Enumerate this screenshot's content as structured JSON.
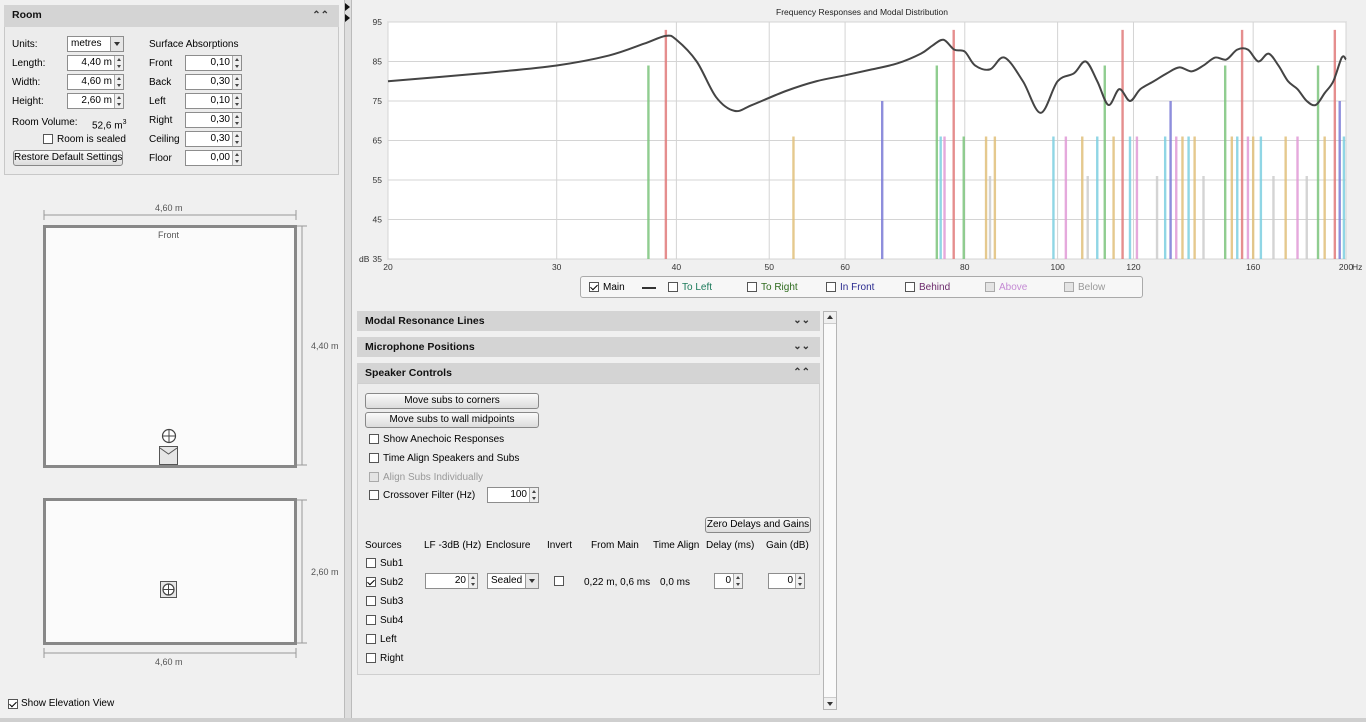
{
  "room": {
    "title": "Room",
    "units_label": "Units:",
    "units_value": "metres",
    "length_label": "Length:",
    "length_value": "4,40 m",
    "width_label": "Width:",
    "width_value": "4,60 m",
    "height_label": "Height:",
    "height_value": "2,60 m",
    "volume_label": "Room Volume:",
    "volume_value": "52,6 m",
    "volume_exp": "3",
    "sealed_label": "Room is sealed",
    "restore_button": "Restore Default Settings",
    "absorption_title": "Surface Absorptions",
    "surfaces": [
      {
        "label": "Front",
        "value": "0,10"
      },
      {
        "label": "Back",
        "value": "0,30"
      },
      {
        "label": "Left",
        "value": "0,10"
      },
      {
        "label": "Right",
        "value": "0,30"
      },
      {
        "label": "Ceiling",
        "value": "0,30"
      },
      {
        "label": "Floor",
        "value": "0,00"
      }
    ]
  },
  "plan": {
    "top_width": "4,60 m",
    "front_label": "Front",
    "depth": "4,40 m",
    "elev_height": "2,60 m",
    "bottom_width": "4,60 m",
    "show_elevation_label": "Show Elevation View"
  },
  "chart_data": {
    "type": "line",
    "title": "Frequency Responses and Modal Distribution",
    "xlabel": "Hz",
    "ylabel": "dB",
    "x_scale": "log",
    "xlim": [
      20,
      200
    ],
    "ylim": [
      35,
      95
    ],
    "x_ticks": [
      "20",
      "30",
      "40",
      "50",
      "60",
      "80",
      "100",
      "120",
      "160",
      "200"
    ],
    "y_ticks": [
      "95",
      "85",
      "75",
      "65",
      "55",
      "45",
      "35"
    ],
    "grid": true,
    "series": [
      {
        "name": "Main",
        "color": "#444444",
        "x": [
          20,
          25,
          30,
          34,
          37,
          39,
          40,
          42,
          44,
          46,
          48,
          52,
          56,
          60,
          64,
          68,
          72,
          74,
          76,
          78,
          80,
          82,
          85,
          88,
          92,
          96,
          100,
          104,
          107,
          110,
          113,
          116,
          119,
          122,
          126,
          130,
          134,
          138,
          142,
          146,
          150,
          154,
          158,
          162,
          166,
          170,
          174,
          178,
          182,
          186,
          190,
          194,
          198,
          200
        ],
        "y": [
          80,
          82,
          84,
          86.5,
          89.5,
          91.5,
          90.5,
          85,
          76,
          72.5,
          74,
          77.5,
          80,
          81.5,
          83,
          84.5,
          87,
          89,
          90.5,
          88,
          87.5,
          84,
          83,
          86,
          80,
          72,
          80,
          82,
          85,
          80,
          74,
          78,
          75,
          78,
          80,
          82,
          83.5,
          82.5,
          84,
          86,
          85.5,
          88,
          88,
          85,
          87,
          84,
          80,
          78,
          75,
          74,
          77,
          80,
          86,
          85.5
        ]
      }
    ],
    "modes": [
      {
        "f": 37.4,
        "db": 84,
        "color": "#7dc47d"
      },
      {
        "f": 39.0,
        "db": 93,
        "color": "#e07a7a"
      },
      {
        "f": 53.0,
        "db": 66,
        "color": "#e0c07a"
      },
      {
        "f": 65.6,
        "db": 75,
        "color": "#7a7ad6"
      },
      {
        "f": 74.8,
        "db": 84,
        "color": "#7dc47d"
      },
      {
        "f": 75.5,
        "db": 66,
        "color": "#7dcfe0"
      },
      {
        "f": 76.2,
        "db": 66,
        "color": "#e09ad6"
      },
      {
        "f": 77.9,
        "db": 93,
        "color": "#e07a7a"
      },
      {
        "f": 79.8,
        "db": 66,
        "color": "#7dc47d"
      },
      {
        "f": 84.2,
        "db": 66,
        "color": "#e0c07a"
      },
      {
        "f": 85.0,
        "db": 56,
        "color": "#cccccc"
      },
      {
        "f": 86.0,
        "db": 66,
        "color": "#e0c07a"
      },
      {
        "f": 99.0,
        "db": 66,
        "color": "#7dcfe0"
      },
      {
        "f": 102.0,
        "db": 66,
        "color": "#e09ad6"
      },
      {
        "f": 106.1,
        "db": 66,
        "color": "#e0c07a"
      },
      {
        "f": 107.5,
        "db": 56,
        "color": "#cccccc"
      },
      {
        "f": 110.0,
        "db": 66,
        "color": "#7dcfe0"
      },
      {
        "f": 112.0,
        "db": 84,
        "color": "#7dc47d"
      },
      {
        "f": 114.4,
        "db": 66,
        "color": "#e0c07a"
      },
      {
        "f": 116.9,
        "db": 93,
        "color": "#e07a7a"
      },
      {
        "f": 119.0,
        "db": 66,
        "color": "#7dcfe0"
      },
      {
        "f": 121.0,
        "db": 66,
        "color": "#e09ad6"
      },
      {
        "f": 127.0,
        "db": 56,
        "color": "#cccccc"
      },
      {
        "f": 129.5,
        "db": 66,
        "color": "#7dcfe0"
      },
      {
        "f": 131.2,
        "db": 75,
        "color": "#7a7ad6"
      },
      {
        "f": 133.0,
        "db": 66,
        "color": "#e09ad6"
      },
      {
        "f": 135.0,
        "db": 66,
        "color": "#e0c07a"
      },
      {
        "f": 137.0,
        "db": 66,
        "color": "#7dcfe0"
      },
      {
        "f": 139.0,
        "db": 66,
        "color": "#e0c07a"
      },
      {
        "f": 142.0,
        "db": 56,
        "color": "#cccccc"
      },
      {
        "f": 149.6,
        "db": 84,
        "color": "#7dc47d"
      },
      {
        "f": 152.0,
        "db": 66,
        "color": "#e0c07a"
      },
      {
        "f": 154.0,
        "db": 66,
        "color": "#7dcfe0"
      },
      {
        "f": 155.8,
        "db": 93,
        "color": "#e07a7a"
      },
      {
        "f": 158.0,
        "db": 66,
        "color": "#e09ad6"
      },
      {
        "f": 160.0,
        "db": 66,
        "color": "#e0c07a"
      },
      {
        "f": 163.0,
        "db": 66,
        "color": "#7dcfe0"
      },
      {
        "f": 168.0,
        "db": 56,
        "color": "#cccccc"
      },
      {
        "f": 173.0,
        "db": 66,
        "color": "#e0c07a"
      },
      {
        "f": 178.0,
        "db": 66,
        "color": "#e09ad6"
      },
      {
        "f": 182.0,
        "db": 56,
        "color": "#cccccc"
      },
      {
        "f": 187.0,
        "db": 84,
        "color": "#7dc47d"
      },
      {
        "f": 190.0,
        "db": 66,
        "color": "#e0c07a"
      },
      {
        "f": 194.7,
        "db": 93,
        "color": "#e07a7a"
      },
      {
        "f": 197.0,
        "db": 75,
        "color": "#7a7ad6"
      },
      {
        "f": 199.0,
        "db": 66,
        "color": "#7dcfe0"
      }
    ]
  },
  "legend": [
    {
      "label": "Main",
      "checked": true,
      "color": "#000000",
      "has_line": true,
      "enabled": true
    },
    {
      "label": "To Left",
      "checked": false,
      "color": "#1b7a5a",
      "has_line": false,
      "enabled": true
    },
    {
      "label": "To Right",
      "checked": false,
      "color": "#2f6b1e",
      "has_line": false,
      "enabled": true
    },
    {
      "label": "In Front",
      "checked": false,
      "color": "#2a2a8f",
      "has_line": false,
      "enabled": true
    },
    {
      "label": "Behind",
      "checked": false,
      "color": "#6b2a6b",
      "has_line": false,
      "enabled": true
    },
    {
      "label": "Above",
      "checked": false,
      "color": "#c48ad4",
      "has_line": false,
      "enabled": false
    },
    {
      "label": "Below",
      "checked": false,
      "color": "#999999",
      "has_line": false,
      "enabled": false
    }
  ],
  "sections": {
    "modal": "Modal Resonance Lines",
    "mic": "Microphone Positions",
    "speaker": "Speaker Controls"
  },
  "speaker": {
    "corners_button": "Move subs to corners",
    "midpoints_button": "Move subs to wall midpoints",
    "anechoic_label": "Show Anechoic Responses",
    "time_align_label": "Time Align Speakers and Subs",
    "align_subs_label": "Align Subs Individually",
    "crossover_label": "Crossover Filter (Hz)",
    "crossover_value": "100",
    "zero_button": "Zero Delays and Gains",
    "headers": [
      "Sources",
      "LF -3dB (Hz)",
      "Enclosure",
      "Invert",
      "From Main",
      "Time Align",
      "Delay (ms)",
      "Gain (dB)"
    ],
    "sources": [
      {
        "label": "Sub1",
        "checked": false
      },
      {
        "label": "Sub2",
        "checked": true
      },
      {
        "label": "Sub3",
        "checked": false
      },
      {
        "label": "Sub4",
        "checked": false
      },
      {
        "label": "Left",
        "checked": false
      },
      {
        "label": "Right",
        "checked": false
      }
    ],
    "sub2": {
      "lf": "20",
      "enclosure": "Sealed",
      "from_main": "0,22 m, 0,6 ms",
      "time_align": "0,0 ms",
      "delay": "0",
      "gain": "0"
    }
  }
}
